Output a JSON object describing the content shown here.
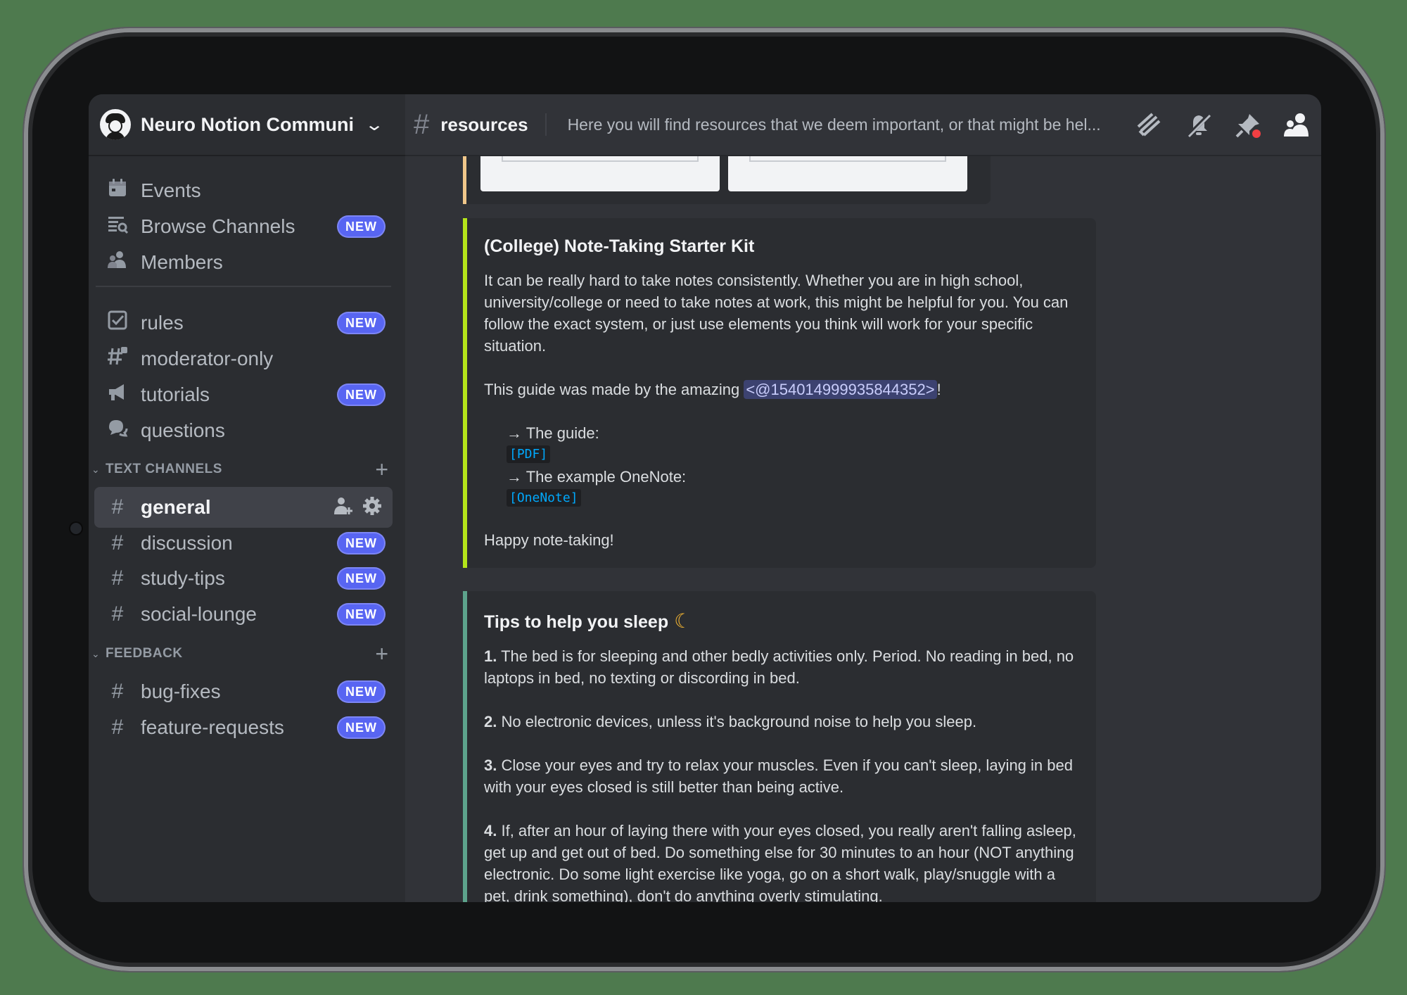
{
  "server": {
    "name": "Neuro Notion Communi",
    "chevron": "chevron-down-icon"
  },
  "nav": {
    "events": "Events",
    "browse_channels": "Browse Channels",
    "members": "Members"
  },
  "badge_label": "NEW",
  "top_channels": [
    {
      "name": "rules",
      "icon": "rules-icon",
      "new": true
    },
    {
      "name": "moderator-only",
      "icon": "hash-lock-icon",
      "new": false
    },
    {
      "name": "tutorials",
      "icon": "megaphone-icon",
      "new": true
    },
    {
      "name": "questions",
      "icon": "forum-icon",
      "new": false
    }
  ],
  "categories": {
    "text_channels": "TEXT CHANNELS",
    "feedback": "FEEDBACK"
  },
  "text_channels": [
    {
      "name": "general",
      "active": true
    },
    {
      "name": "discussion",
      "new": true
    },
    {
      "name": "study-tips",
      "new": true
    },
    {
      "name": "social-lounge",
      "new": true
    }
  ],
  "feedback_channels": [
    {
      "name": "bug-fixes",
      "new": true
    },
    {
      "name": "feature-requests",
      "new": true
    }
  ],
  "channel": {
    "hash": "#",
    "name": "resources",
    "topic": "Here you will find resources that we deem important, or that might be hel..."
  },
  "embeds": {
    "note_kit": {
      "title": "(College) Note-Taking Starter Kit",
      "body": "It can be really hard to take notes consistently. Whether you are in high school, university/college or need to take notes at work, this might be helpful for you. You can follow the exact system, or just use elements you think will work for your specific situation.",
      "credit_prefix": "This guide was made by the amazing ",
      "mention": "<@154014999935844352>",
      "credit_suffix": "!",
      "guide_label": "→ The guide:",
      "guide_link": "[PDF]",
      "onenote_label": "→ The example OneNote:",
      "onenote_link": "[OneNote]",
      "closing": "Happy note-taking!"
    },
    "sleep": {
      "title": "Tips to help you sleep",
      "tips": [
        {
          "num": "1.",
          "text": " The bed is for sleeping and other bedly activities only. Period. No reading in bed, no laptops in bed, no texting or discording in bed."
        },
        {
          "num": "2.",
          "text": " No electronic devices, unless it's background noise to help you sleep."
        },
        {
          "num": "3.",
          "text": " Close your eyes and try to relax your muscles. Even if you can't sleep, laying in bed with your eyes closed is still better than being active."
        },
        {
          "num": "4.",
          "text": " If, after an hour of laying there with your eyes closed, you really aren't falling asleep, get up and get out of bed. Do something else for 30 minutes to an hour (NOT anything electronic. Do some light exercise like yoga, go on a short walk, play/snuggle with a pet, drink something), don't do anything overly stimulating."
        }
      ]
    }
  },
  "colors": {
    "accent": "#5865f2",
    "embed_green": "#b4e51a",
    "embed_teal": "#5da38c",
    "link": "#00a8fc",
    "notification_dot": "#f23f43"
  }
}
